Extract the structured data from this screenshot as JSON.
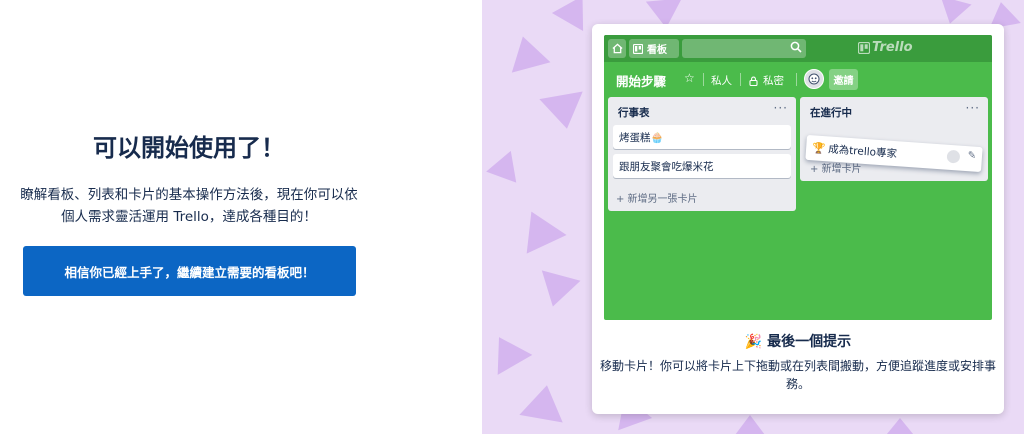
{
  "intro": {
    "headline": "可以開始使用了！",
    "description": "瞭解看板、列表和卡片的基本操作方法後，現在你可以依個人需求靈活運用 Trello，達成各種目的！",
    "cta_label": "相信你已經上手了，繼續建立需要的看板吧！"
  },
  "board_preview": {
    "topbar": {
      "boards_label": "看板",
      "logo_text": "Trello"
    },
    "board_title": "開始步驟",
    "visibility": "私人",
    "privacy": "私密",
    "invite_label": "邀請",
    "lists": [
      {
        "title": "行事表",
        "cards": [
          "烤蛋糕🧁",
          "跟朋友聚會吃爆米花"
        ],
        "add_label": "+ 新增另一張卡片"
      },
      {
        "title": "在進行中",
        "add_label": "+ 新增卡片"
      }
    ],
    "dragging_card": "成為trello專家"
  },
  "tip": {
    "title": "最後一個提示",
    "text": "移動卡片！你可以將卡片上下拖動或在列表間搬動，方便追蹤進度或安排事務。"
  },
  "colors": {
    "cta": "#0c66c4",
    "board_bg": "#4bbb4b",
    "topbar": "#3a9c3d",
    "right_bg": "#eadaf6",
    "triangle": "#d5b6ef"
  }
}
